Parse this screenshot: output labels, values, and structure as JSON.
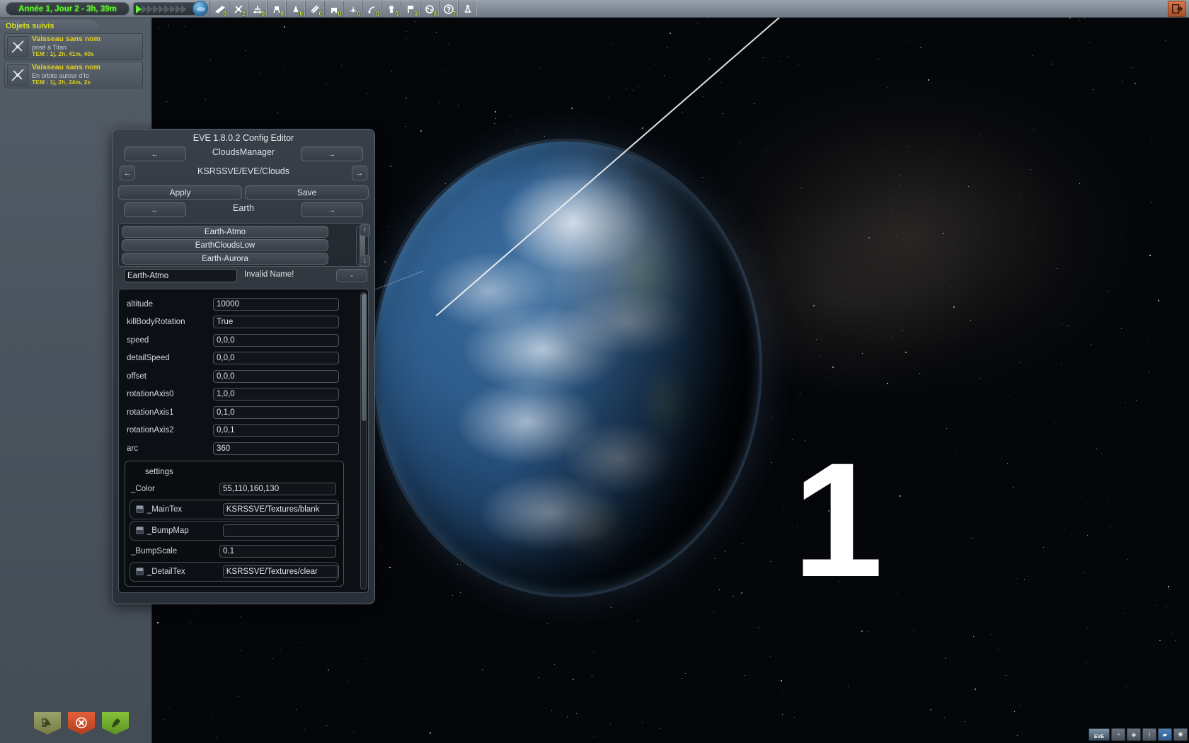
{
  "topbar": {
    "clock": "Année 1, Jour  2 - 3h, 39m",
    "warp_on_count": 1,
    "warp_total": 9,
    "exit_icon": "exit-icon",
    "tools": [
      {
        "icon": "debris-icon",
        "count": "0"
      },
      {
        "icon": "probe-icon",
        "count": "2"
      },
      {
        "icon": "rover-icon",
        "count": "0"
      },
      {
        "icon": "lander-icon",
        "count": "8"
      },
      {
        "icon": "ship-icon",
        "count": "0"
      },
      {
        "icon": "station-icon",
        "count": "0"
      },
      {
        "icon": "base-icon",
        "count": "0"
      },
      {
        "icon": "plane-icon",
        "count": "0"
      },
      {
        "icon": "relay-icon",
        "count": "0"
      },
      {
        "icon": "kerbal-icon",
        "count": "0"
      },
      {
        "icon": "flag-icon",
        "count": "0"
      },
      {
        "icon": "asteroid-icon",
        "count": "0"
      },
      {
        "icon": "unknown-icon",
        "count": "7"
      },
      {
        "icon": "science-icon",
        "count": ""
      }
    ]
  },
  "sidebar": {
    "tab_label": "Objets suivis",
    "vessels": [
      {
        "name": "Vaisseau sans nom",
        "status": "posé à Titan",
        "tem": "TEM : 1j, 2h, 41m, 40s",
        "icon": "probe-icon"
      },
      {
        "name": "Vaisseau sans nom",
        "status": "En orbite autour d'Io",
        "tem": "TEM : 1j, 2h, 24m, 2s",
        "icon": "probe-icon"
      }
    ],
    "bottom_buttons": [
      {
        "name": "recover-vessel-button",
        "icon": "recover-icon",
        "color": "#8a9260"
      },
      {
        "name": "terminate-vessel-button",
        "icon": "close-icon",
        "color": "#d4552d"
      },
      {
        "name": "fly-vessel-button",
        "icon": "rocket-icon",
        "color": "#77b22e"
      }
    ]
  },
  "eve": {
    "title": "EVE 1.8.0.2 Config Editor",
    "manager_prev": "←",
    "manager_name": "CloudsManager",
    "manager_next": "→",
    "config_back": "←",
    "config_path": "KSRSSVE/EVE/Clouds",
    "config_fwd": "→",
    "apply_label": "Apply",
    "save_label": "Save",
    "body_prev": "←",
    "body_name": "Earth",
    "body_next": "→",
    "layers": [
      "Earth-Atmo",
      "EarthCloudsLow",
      "Earth-Aurora"
    ],
    "scroll_up": "↑",
    "scroll_down": "↓",
    "name_value": "Earth-Atmo",
    "invalid_label": "Invalid Name!",
    "remove_label": "-",
    "properties": [
      {
        "label": "altitude",
        "value": "10000"
      },
      {
        "label": "killBodyRotation",
        "value": "True"
      },
      {
        "label": "speed",
        "value": "0,0,0"
      },
      {
        "label": "detailSpeed",
        "value": "0,0,0"
      },
      {
        "label": "offset",
        "value": "0,0,0"
      },
      {
        "label": "rotationAxis0",
        "value": "1,0,0"
      },
      {
        "label": "rotationAxis1",
        "value": "0,1,0"
      },
      {
        "label": "rotationAxis2",
        "value": "0,0,1"
      },
      {
        "label": "arc",
        "value": "360"
      }
    ],
    "settings": {
      "title": "settings",
      "rows": [
        {
          "label": "_Color",
          "value": "55,110,160,130",
          "toggle": false
        },
        {
          "label": "_MainTex",
          "value": "KSRSSVE/Textures/blank",
          "toggle": true
        },
        {
          "label": "_BumpMap",
          "value": "",
          "toggle": true
        },
        {
          "label": "_BumpScale",
          "value": "0.1",
          "toggle": false
        },
        {
          "label": "_DetailTex",
          "value": "KSRSSVE/Textures/clear",
          "toggle": true
        }
      ]
    }
  },
  "scene": {
    "body_name": "Earth",
    "vessel_marker": "1",
    "colors": {
      "ocean": "#2d5b8a",
      "clouds": "#eef2f7",
      "orbit_line": "#f2f4f6",
      "highlight_yellow": "#e8d11d",
      "time_green": "#5ef72a"
    }
  },
  "tray": {
    "eve_label": "EVE",
    "buttons": [
      {
        "name": "tray-clock-button",
        "glyph": "◔"
      },
      {
        "name": "tray-target-button",
        "glyph": "◈"
      },
      {
        "name": "tray-info-button",
        "glyph": "i"
      },
      {
        "name": "tray-eve-settings-button",
        "glyph": "▰"
      },
      {
        "name": "tray-atmosphere-button",
        "glyph": "✺"
      }
    ]
  }
}
